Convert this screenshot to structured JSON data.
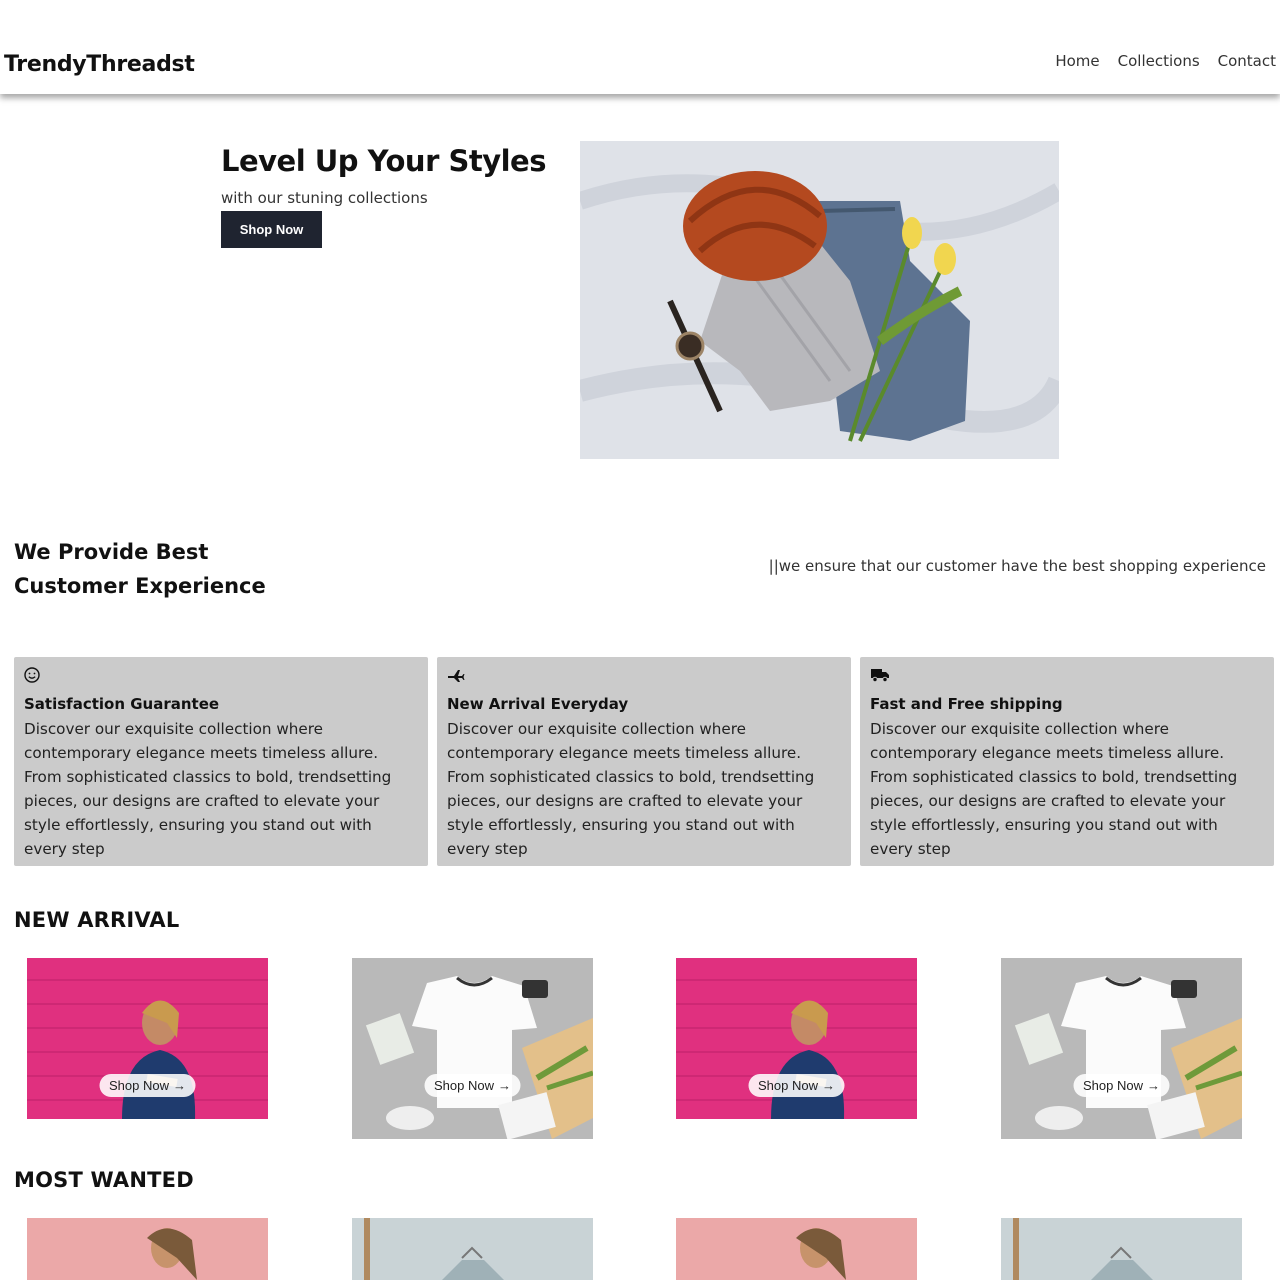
{
  "header": {
    "brand": "TrendyThreadst",
    "nav": [
      "Home",
      "Collections",
      "Contact"
    ]
  },
  "hero": {
    "title": "Level Up Your Styles",
    "subtitle": "with our stuning collections",
    "button_label": "Shop Now"
  },
  "experience": {
    "title_line1": "We Provide Best",
    "title_line2": "Customer Experience",
    "note": "||we ensure that our customer have the best shopping experience"
  },
  "features": [
    {
      "icon": "smile-icon",
      "title": "Satisfaction Guarantee",
      "text": "Discover our exquisite collection where contemporary elegance meets timeless allure. From sophisticated classics to bold, trendsetting pieces, our designs are crafted to elevate your style effortlessly, ensuring you stand out with every step"
    },
    {
      "icon": "plane-icon",
      "title": "New Arrival Everyday",
      "text": "Discover our exquisite collection where contemporary elegance meets timeless allure. From sophisticated classics to bold, trendsetting pieces, our designs are crafted to elevate your style effortlessly, ensuring you stand out with every step"
    },
    {
      "icon": "truck-icon",
      "title": "Fast and Free shipping",
      "text": "Discover our exquisite collection where contemporary elegance meets timeless allure. From sophisticated classics to bold, trendsetting pieces, our designs are crafted to elevate your style effortlessly, ensuring you stand out with every step"
    }
  ],
  "new_arrival": {
    "title": "NEW ARRIVAL",
    "shop_label": "Shop Now",
    "shop_arrow": "→"
  },
  "most_wanted": {
    "title": "MOST WANTED"
  },
  "colors": {
    "button_dark": "#1f2430",
    "card_bg": "#cbcbcb",
    "pink_wall": "#e0307f"
  }
}
